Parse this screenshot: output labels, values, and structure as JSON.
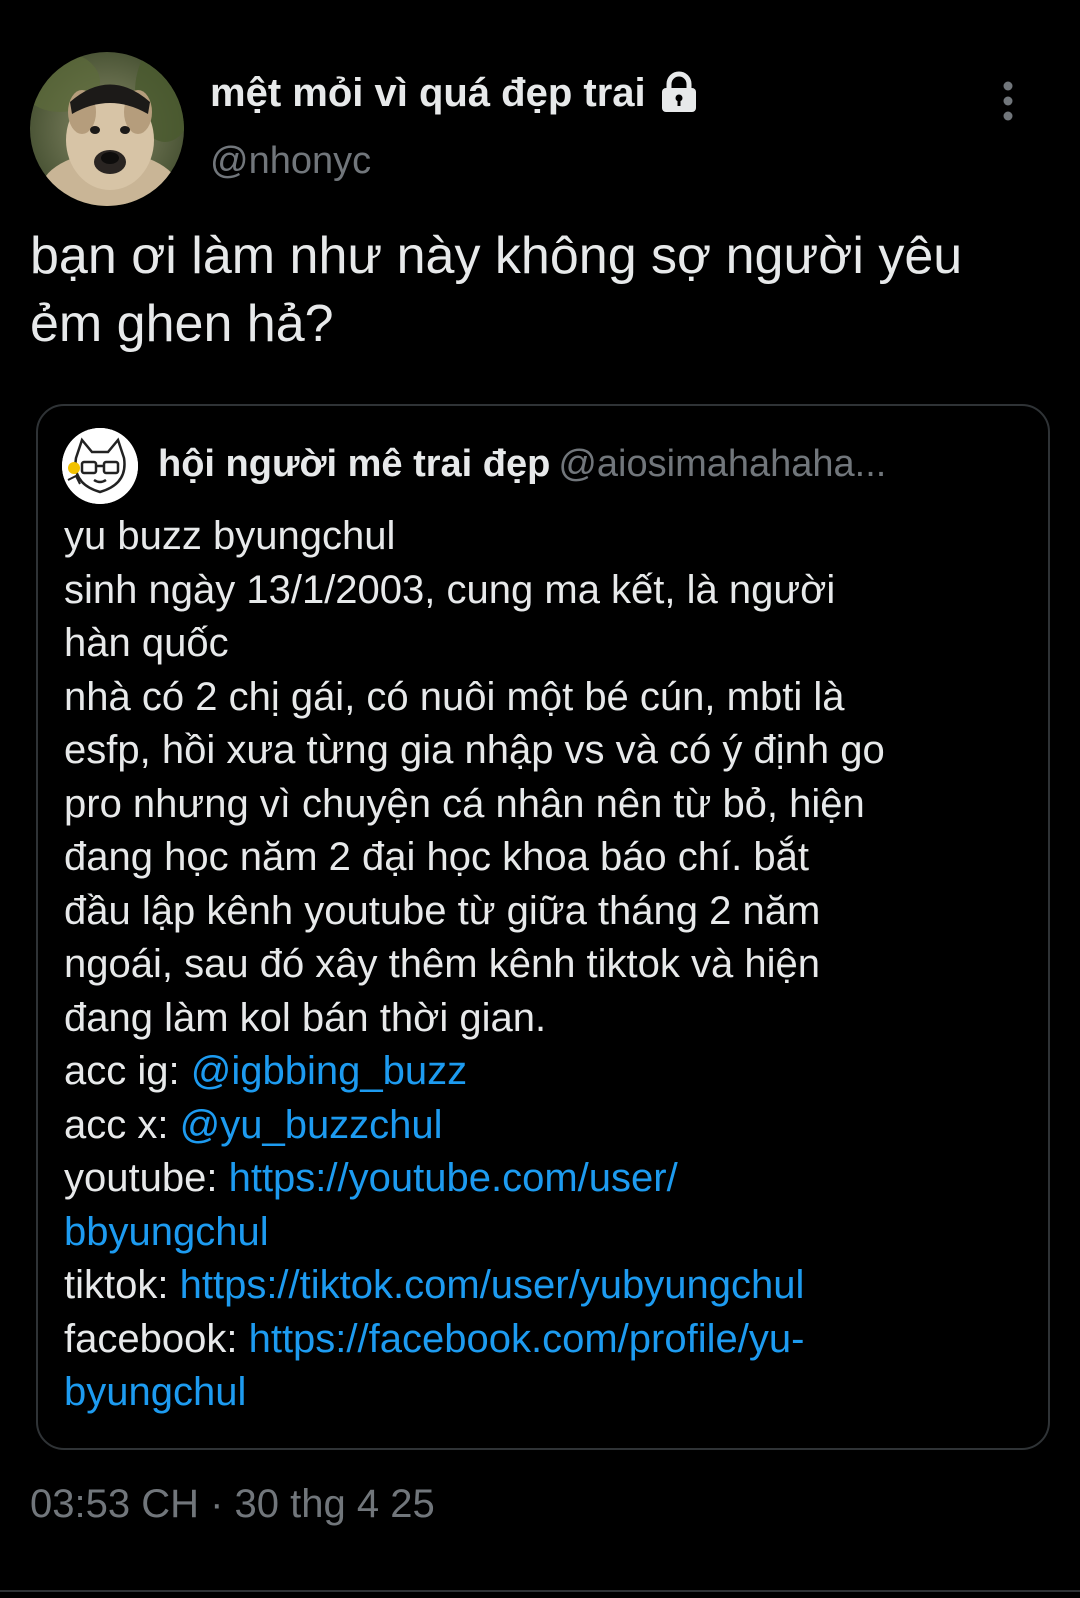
{
  "tweet": {
    "author": {
      "display_name": "mệt mỏi vì quá đẹp trai",
      "handle": "@nhonyc",
      "avatar_icon": "dog-avatar",
      "protected_icon": "lock-icon"
    },
    "more_icon": "vertical-ellipsis-icon",
    "text_lines": [
      "bạn ơi làm như này không sợ người yêu",
      "ẻm ghen hả?"
    ],
    "quote": {
      "author": {
        "display_name": "hội người mê trai đẹp",
        "handle": "@aiosimahahaha...",
        "avatar_icon": "cat-avatar"
      },
      "text_lines": [
        "yu buzz byungchul",
        "sinh ngày 13/1/2003, cung ma kết, là người",
        "hàn quốc",
        "nhà có 2 chị gái, có nuôi một bé cún, mbti là",
        "esfp, hồi xưa từng gia nhập vs và có ý định go",
        "pro nhưng vì chuyện cá nhân nên từ bỏ, hiện",
        "đang học năm 2 đại học khoa báo chí. bắt",
        "đầu lập kênh youtube từ giữa tháng 2 năm",
        "ngoái, sau đó xây thêm kênh tiktok và hiện",
        "đang làm kol bán thời gian."
      ],
      "links": {
        "ig_label": "acc ig: ",
        "ig_value": "@igbbing_buzz",
        "x_label": "acc x: ",
        "x_value": "@yu_buzzchul",
        "youtube_label": "youtube: ",
        "youtube_value_line1": "https://youtube.com/user/",
        "youtube_value_line2": "bbyungchul",
        "tiktok_label": "tiktok: ",
        "tiktok_value": "https://tiktok.com/user/yubyungchul",
        "facebook_label": "facebook: ",
        "facebook_value_line1": "https://facebook.com/profile/yu-",
        "facebook_value_line2": "byungchul"
      }
    },
    "timestamp": "03:53 CH · 30 thg 4 25"
  },
  "colors": {
    "background": "#000000",
    "text_primary": "#e7e9ea",
    "text_secondary": "#71767b",
    "link": "#1d9bf0",
    "border": "#2f3336"
  }
}
